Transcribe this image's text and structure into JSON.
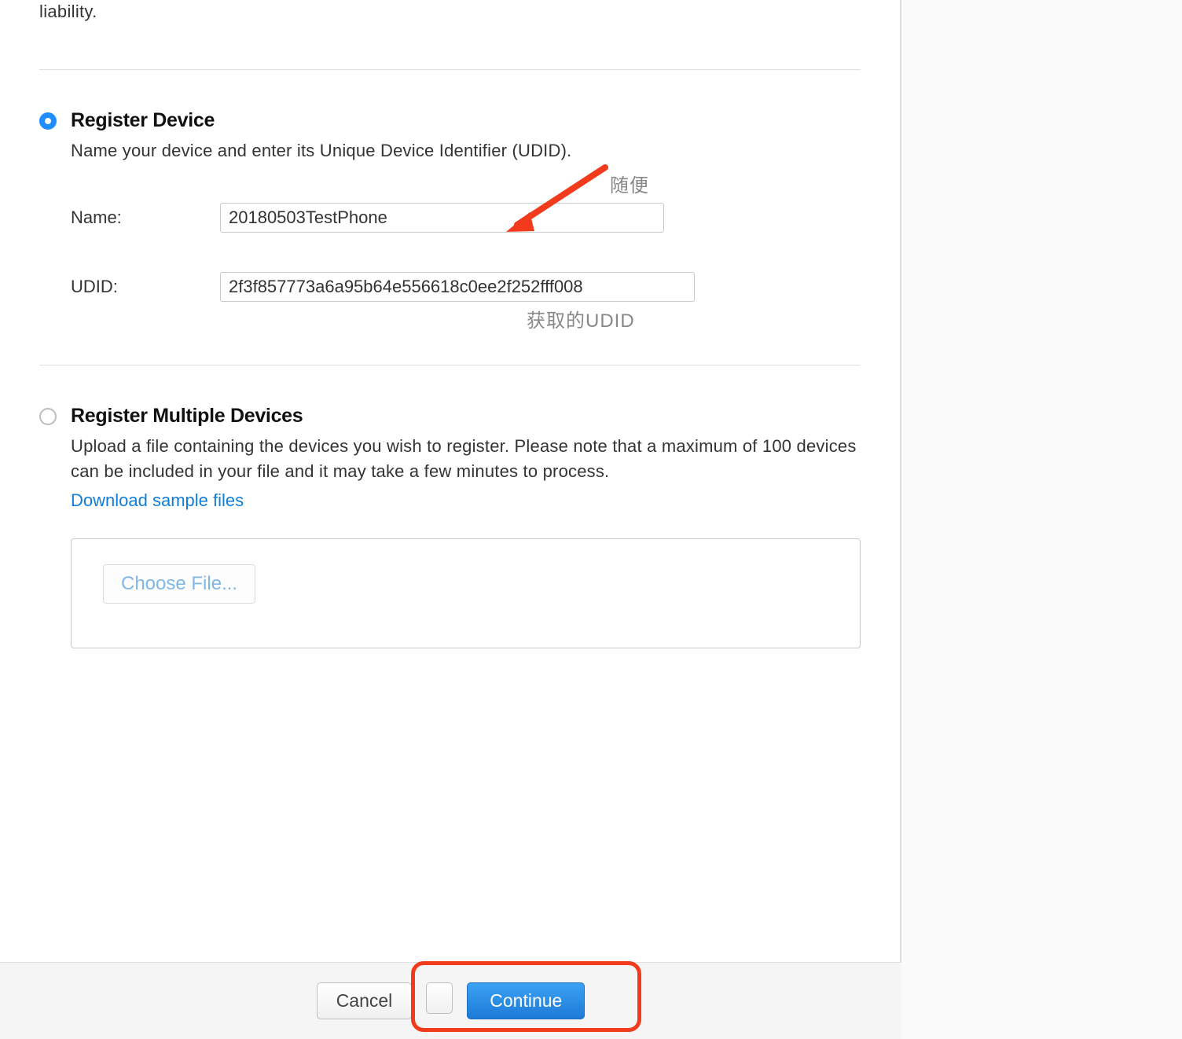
{
  "top_fragment": "liability.",
  "register_device": {
    "title": "Register Device",
    "description": "Name your device and enter its Unique Device Identifier (UDID).",
    "name_label": "Name:",
    "name_value": "20180503TestPhone",
    "udid_label": "UDID:",
    "udid_value": "2f3f857773a6a95b64e556618c0ee2f252fff008"
  },
  "annotations": {
    "name_note": "随便",
    "udid_note": "获取的UDID"
  },
  "register_multiple": {
    "title": "Register Multiple Devices",
    "description": "Upload a file containing the devices you wish to register. Please note that a maximum of 100 devices can be included in your file and it may take a few minutes to process.",
    "download_link": "Download sample files",
    "choose_file": "Choose File..."
  },
  "footer": {
    "cancel": "Cancel",
    "continue": "Continue"
  }
}
